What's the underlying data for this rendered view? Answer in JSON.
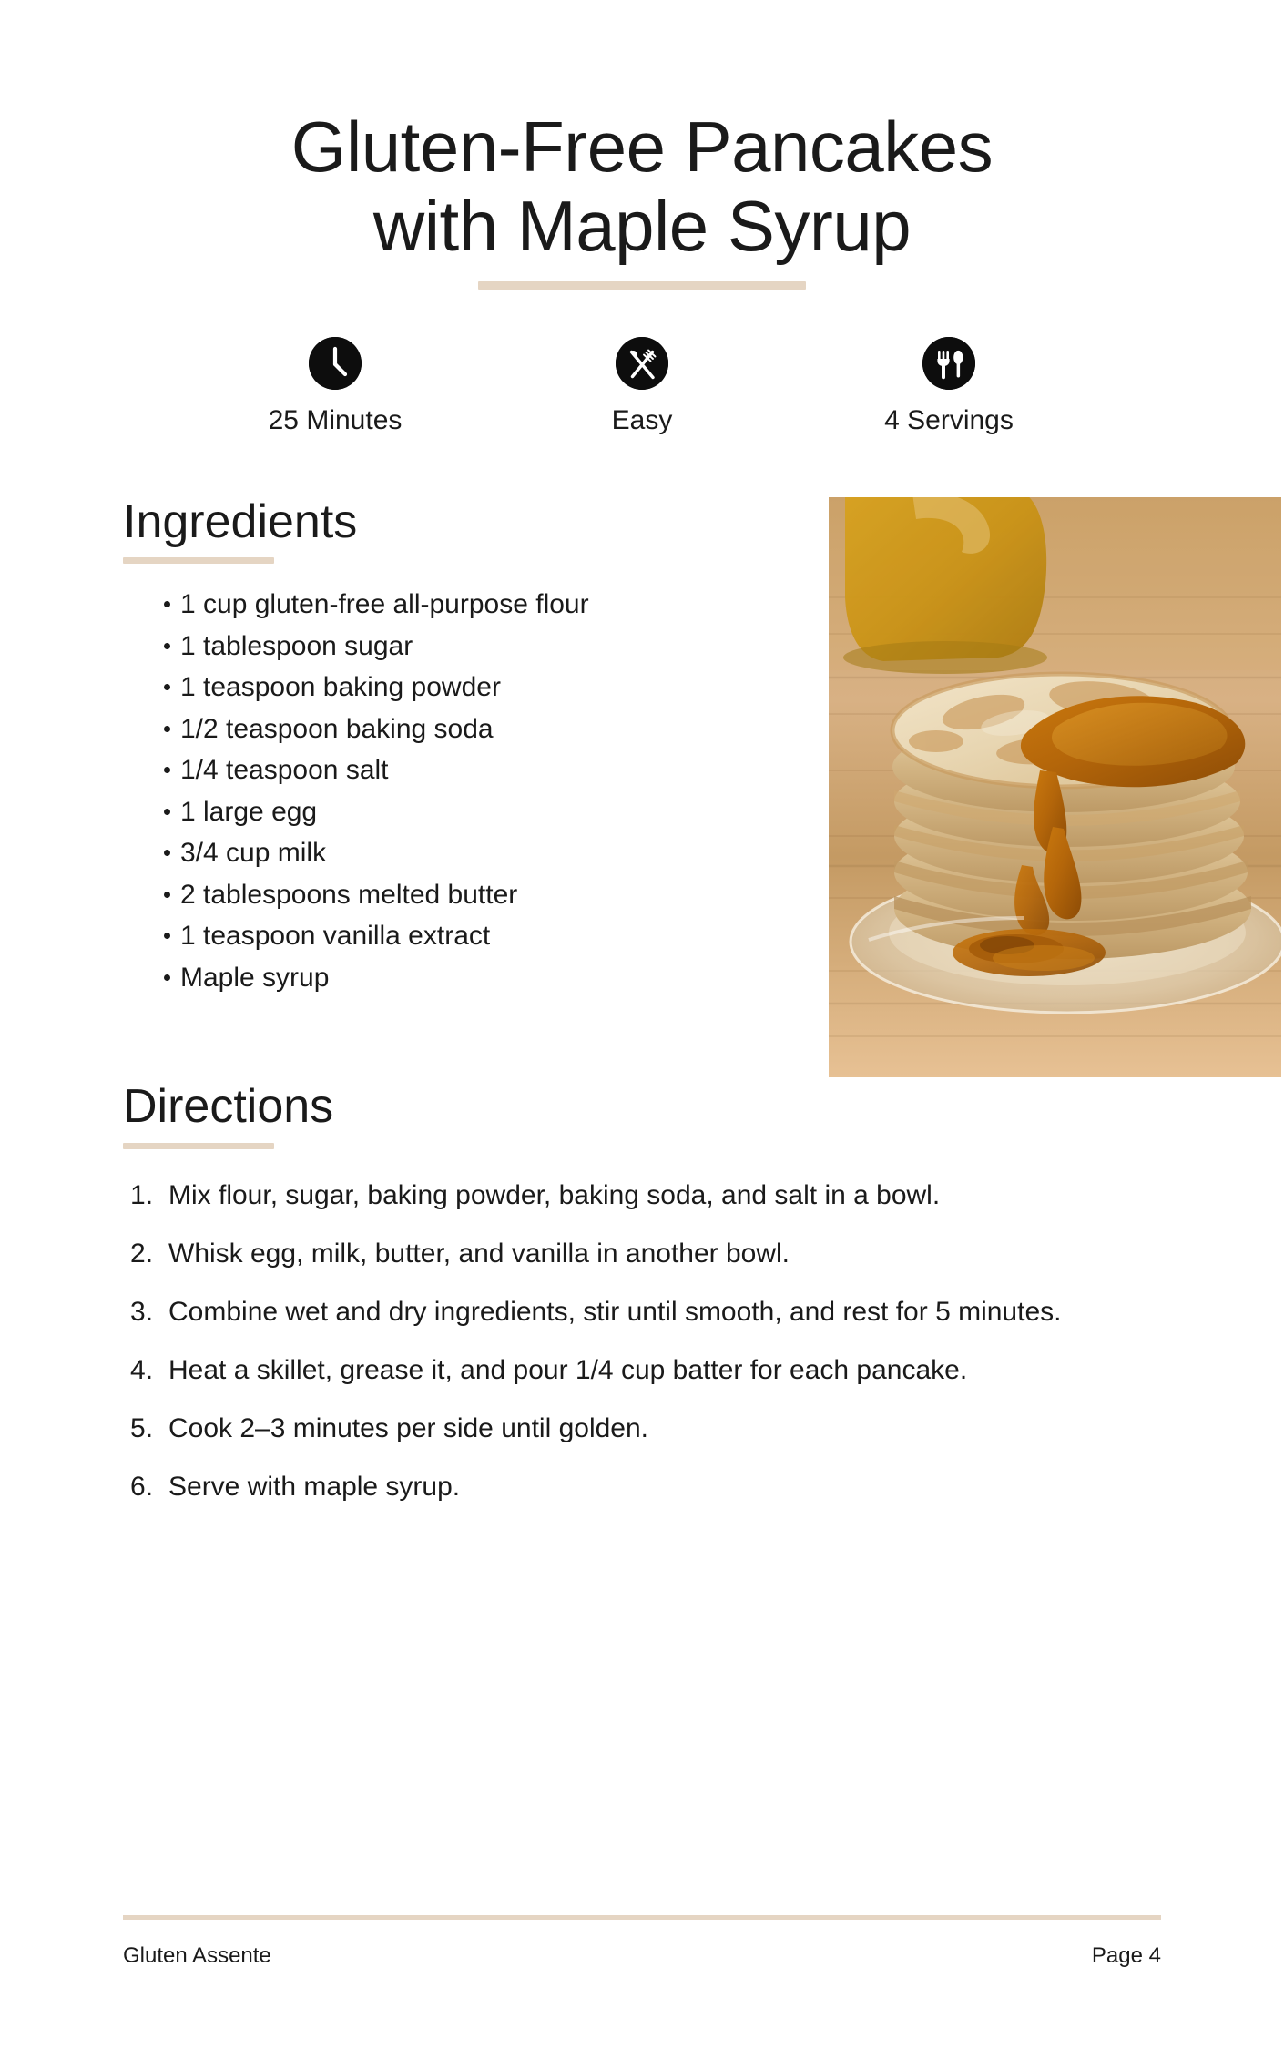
{
  "recipe": {
    "title_line1": "Gluten-Free Pancakes",
    "title_line2": "with Maple Syrup"
  },
  "meta": [
    {
      "icon": "clock-icon",
      "label": "25 Minutes"
    },
    {
      "icon": "fork-knife-icon",
      "label": "Easy"
    },
    {
      "icon": "fork-spoon-icon",
      "label": "4 Servings"
    }
  ],
  "ingredients": {
    "heading": "Ingredients",
    "items": [
      "1 cup gluten-free all-purpose flour",
      "1 tablespoon sugar",
      "1 teaspoon baking powder",
      "1/2 teaspoon baking soda",
      "1/4 teaspoon salt",
      "1 large egg",
      "3/4 cup milk",
      "2 tablespoons melted butter",
      "1 teaspoon vanilla extract",
      "Maple syrup"
    ]
  },
  "photo": {
    "alt": "Stack of pancakes drizzled with maple syrup on a glass plate"
  },
  "directions": {
    "heading": "Directions",
    "steps": [
      "Mix flour, sugar, baking powder, baking soda, and salt in a bowl.",
      "Whisk egg, milk, butter, and vanilla in another bowl.",
      "Combine wet and dry ingredients, stir until smooth, and rest for 5 minutes.",
      "Heat a skillet, grease it, and pour 1/4 cup batter for each pancake.",
      "Cook 2–3 minutes per side until golden.",
      "Serve with maple syrup."
    ]
  },
  "footer": {
    "left": "Gluten Assente",
    "right": "Page 4"
  },
  "colors": {
    "accent": "#E5D5C3",
    "text": "#1a1a1a",
    "icon_bg": "#0d0d0d",
    "background": "#ffffff"
  }
}
